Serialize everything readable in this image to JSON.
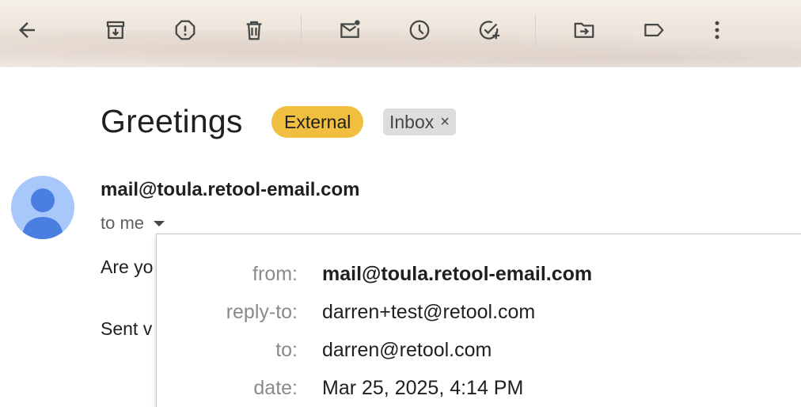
{
  "toolbar": {
    "buttons": [
      {
        "name": "back",
        "icon": "arrow-left-icon"
      },
      {
        "name": "archive",
        "icon": "archive-icon"
      },
      {
        "name": "report-spam",
        "icon": "report-spam-icon"
      },
      {
        "name": "delete",
        "icon": "trash-icon"
      },
      {
        "name": "mark-unread",
        "icon": "mark-unread-icon"
      },
      {
        "name": "snooze",
        "icon": "clock-icon"
      },
      {
        "name": "add-task",
        "icon": "add-task-icon"
      },
      {
        "name": "move-to",
        "icon": "move-to-folder-icon"
      },
      {
        "name": "label",
        "icon": "label-icon"
      },
      {
        "name": "more",
        "icon": "more-vert-icon"
      }
    ]
  },
  "email": {
    "subject": "Greetings",
    "labels": {
      "external": "External",
      "inbox": "Inbox",
      "remove_symbol": "×"
    },
    "sender": "mail@toula.retool-email.com",
    "recipient_summary": "to me",
    "body_line_1": "Are yo",
    "body_line_2": "Sent v"
  },
  "details": {
    "rows": [
      {
        "key": "from:",
        "value": "mail@toula.retool-email.com"
      },
      {
        "key": "reply-to:",
        "value": "darren+test@retool.com"
      },
      {
        "key": "to:",
        "value": "darren@retool.com"
      },
      {
        "key": "date:",
        "value": "Mar 25, 2025, 4:14 PM"
      }
    ]
  },
  "colors": {
    "external_chip": "#f0bf3f",
    "inbox_chip": "#dddddd",
    "avatar_bg": "#a8c7fa",
    "avatar_fg": "#4a7ee0",
    "icon": "#444746"
  }
}
